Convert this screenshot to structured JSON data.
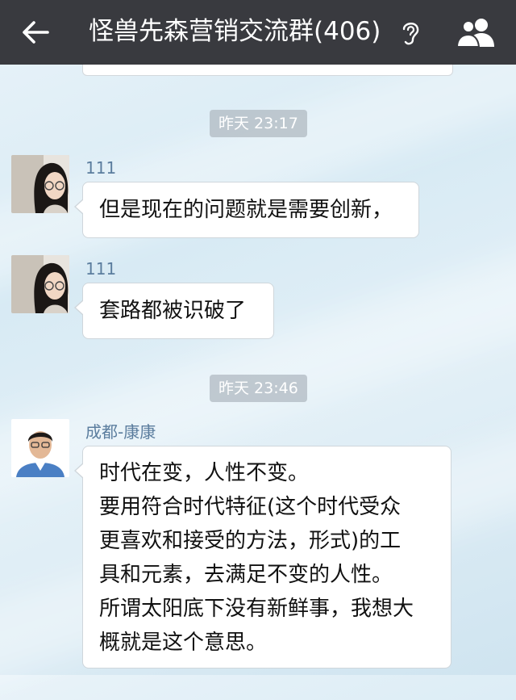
{
  "header": {
    "title": "怪兽先森营销交流群(406)"
  },
  "messages": [
    {
      "timestamp": "昨天 23:17",
      "sender": "111",
      "text": "但是现在的问题就是需要创新，"
    },
    {
      "sender": "111",
      "text": "套路都被识破了"
    },
    {
      "timestamp": "昨天 23:46",
      "sender": "成都-康康",
      "lines": [
        "时代在变，人性不变。",
        "要用符合时代特征(这个时代受众",
        "更喜欢和接受的方法，形式)的工",
        "具和元素，去满足不变的人性。",
        "所谓太阳底下没有新鲜事，我想大",
        "概就是这个意思。"
      ]
    }
  ],
  "icons": [
    "back-arrow-icon",
    "ear-icon",
    "group-members-icon"
  ],
  "colors": {
    "topbar": "#393a3f",
    "sender_name": "#5b7d9e",
    "timestamp_bg": "#b0bac1"
  }
}
